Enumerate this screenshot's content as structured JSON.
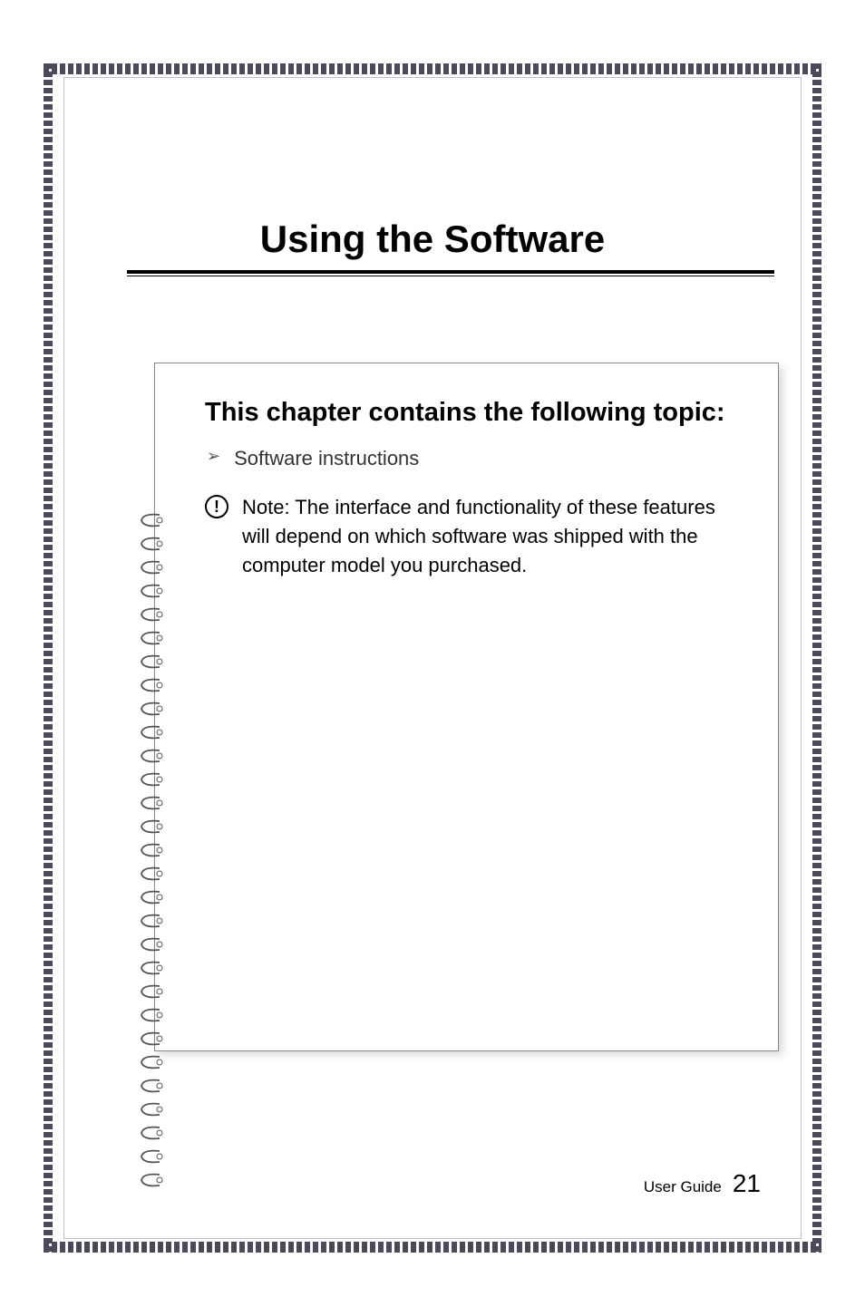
{
  "chapter": {
    "title": "Using the Software"
  },
  "section": {
    "heading": "This chapter contains the following topic:",
    "bullet_item": "Software instructions"
  },
  "note": {
    "label": "Note:",
    "text": " The interface and functionality of these features will depend on which software was shipped with the computer model you purchased."
  },
  "footer": {
    "label": "User Guide",
    "page_number": "21"
  }
}
